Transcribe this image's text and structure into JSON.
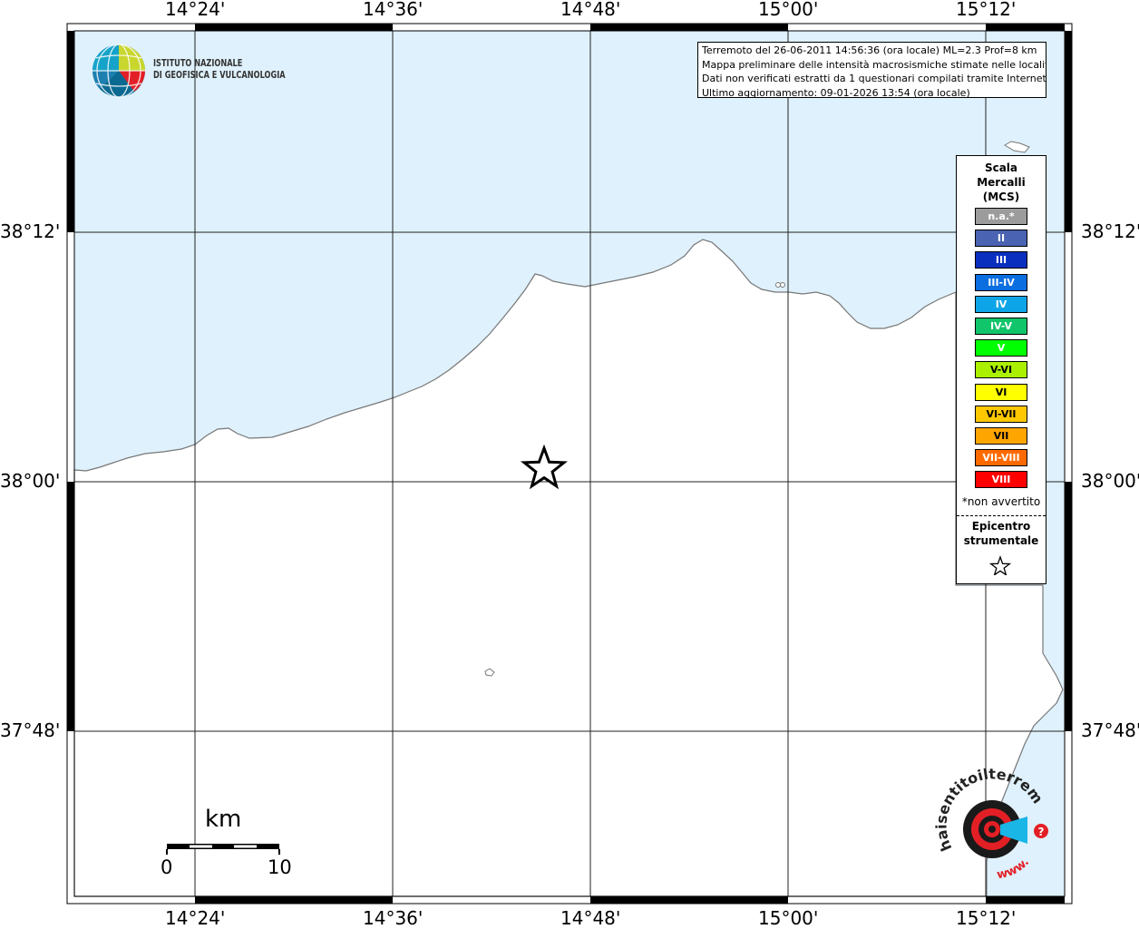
{
  "map": {
    "x_ticks": [
      "14°24'",
      "14°36'",
      "14°48'",
      "15°00'",
      "15°12'"
    ],
    "y_ticks": [
      "38°12'",
      "38°00'",
      "37°48'"
    ],
    "colors": {
      "sea": "#dff1fc",
      "land": "#ffffff",
      "coast": "#777777"
    }
  },
  "info": {
    "line1": "Terremoto del 26-06-2011 14:56:36 (ora locale) ML=2.3 Prof=8 km",
    "line2": "Mappa preliminare delle intensità macrosismiche stimate nelle località",
    "line3": "Dati non verificati estratti da 1 questionari compilati tramite Internet.",
    "line4": "Ultimo aggiornamento: 09-01-2026 13:54 (ora locale)"
  },
  "logo": {
    "line1": "ISTITUTO NAZIONALE",
    "line2": "DI GEOFISICA E VULCANOLOGIA"
  },
  "legend": {
    "title1": "Scala",
    "title2": "Mercalli",
    "title3": "(MCS)",
    "items": [
      {
        "label": "n.a.*",
        "color": "#9c9c9c"
      },
      {
        "label": "II",
        "color": "#4a63b2"
      },
      {
        "label": "III",
        "color": "#0a2fbf"
      },
      {
        "label": "III-IV",
        "color": "#0a6ee0"
      },
      {
        "label": "IV",
        "color": "#0ea5e8"
      },
      {
        "label": "IV-V",
        "color": "#10c56a"
      },
      {
        "label": "V",
        "color": "#00ff00"
      },
      {
        "label": "V-VI",
        "color": "#aaf000"
      },
      {
        "label": "VI",
        "color": "#ffff00"
      },
      {
        "label": "VI-VII",
        "color": "#ffc800"
      },
      {
        "label": "VII",
        "color": "#ffa500"
      },
      {
        "label": "VII-VIII",
        "color": "#ff6a00"
      },
      {
        "label": "VIII",
        "color": "#ff0000"
      }
    ],
    "note": "*non avvertito",
    "epicentro1": "Epicentro",
    "epicentro2": "strumentale"
  },
  "scale": {
    "unit": "km",
    "min": "0",
    "max": "10"
  },
  "badge": {
    "text_top": "haisentitoilterremoto.it",
    "text_bottom": "www.",
    "question": "?"
  }
}
